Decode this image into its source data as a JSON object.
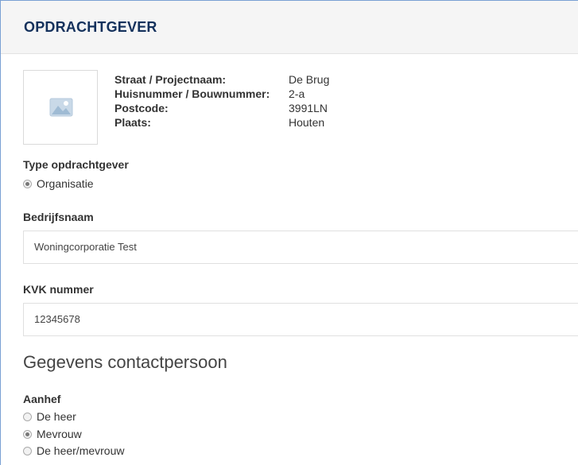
{
  "header": {
    "title": "OPDRACHTGEVER"
  },
  "project": {
    "rows": [
      {
        "label": "Straat / Projectnaam:",
        "value": "De Brug"
      },
      {
        "label": "Huisnummer / Bouwnummer:",
        "value": "2-a"
      },
      {
        "label": "Postcode:",
        "value": "3991LN"
      },
      {
        "label": "Plaats:",
        "value": "Houten"
      }
    ],
    "image_icon": "image-placeholder-icon"
  },
  "type_opdrachtgever": {
    "label": "Type opdrachtgever",
    "options": [
      {
        "label": "Organisatie",
        "checked": true
      }
    ]
  },
  "bedrijfsnaam": {
    "label": "Bedrijfsnaam",
    "value": "Woningcorporatie Test"
  },
  "kvk": {
    "label": "KVK nummer",
    "value": "12345678"
  },
  "contact": {
    "title": "Gegevens contactpersoon"
  },
  "aanhef": {
    "label": "Aanhef",
    "options": [
      {
        "label": "De heer",
        "checked": false
      },
      {
        "label": "Mevrouw",
        "checked": true
      },
      {
        "label": "De heer/mevrouw",
        "checked": false
      }
    ]
  },
  "colors": {
    "header_title": "#14315c",
    "frame_border": "#7aa0d4",
    "header_bg": "#f5f5f5"
  }
}
